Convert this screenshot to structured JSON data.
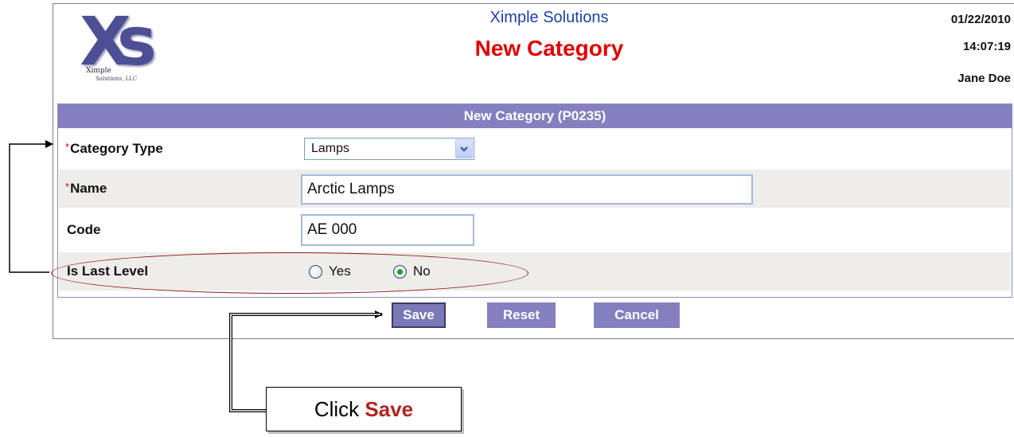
{
  "header": {
    "logo": {
      "mark": "Xs",
      "line1": "Ximple",
      "line2": "Solutions, LLC"
    },
    "company": "Ximple Solutions",
    "title": "New Category",
    "date": "01/22/2010",
    "time": "14:07:19",
    "user": "Jane Doe"
  },
  "form": {
    "header": "New Category (P0235)",
    "required_marker": "*",
    "fields": {
      "category_type": {
        "label": "Category Type",
        "value": "Lamps",
        "required": true
      },
      "name": {
        "label": "Name",
        "value": "Arctic Lamps",
        "required": true
      },
      "code": {
        "label": "Code",
        "value": "AE 000",
        "required": false
      },
      "is_last_level": {
        "label": "Is Last Level",
        "options": [
          "Yes",
          "No"
        ],
        "selected": "No"
      }
    }
  },
  "buttons": {
    "save": "Save",
    "reset": "Reset",
    "cancel": "Cancel"
  },
  "annotation": {
    "prefix": "Click ",
    "emphasis": "Save"
  },
  "colors": {
    "panel_header": "#8480c0",
    "brand_text": "#1f3ea8",
    "title_text": "#e00000",
    "highlight": "#8b1a1a"
  },
  "icons": [
    "dropdown-chevron-icon",
    "arrow-icon"
  ]
}
